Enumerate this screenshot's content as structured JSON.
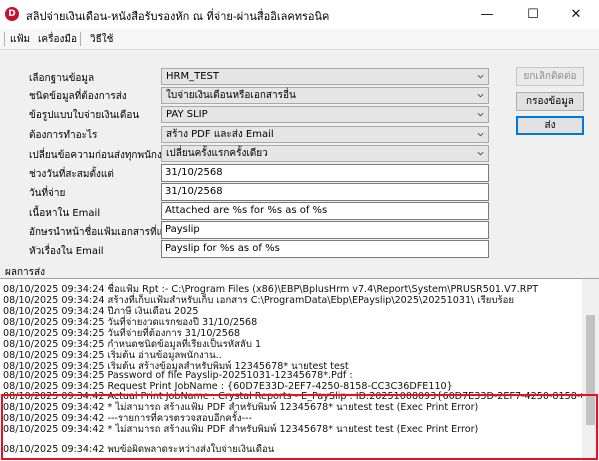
{
  "window": {
    "app_icon_letter": "D",
    "title": "สลิปจ่ายเงินเดือน-หนังสือรับรองหัก ณ ที่จ่าย-ผ่านสื่ออิเลคทรอนิค",
    "controls": {
      "minimize": "—",
      "maximize": "☐",
      "close": "✕"
    }
  },
  "menu": {
    "items": [
      "แฟ้ม",
      "เครื่องมือ",
      "วิธีใช้"
    ]
  },
  "form": {
    "rows": [
      {
        "label": "เลือกฐานข้อมูล",
        "value": "HRM_TEST"
      },
      {
        "label": "ชนิดข้อมูลที่ต้องการส่ง",
        "value": "ใบจ่ายเงินเดือนหรือเอกสารอื่น"
      },
      {
        "label": "ข้อรูปแบบใบจ่ายเงินเดือน",
        "value": "PAY SLIP"
      },
      {
        "label": "ต้องการทำอะไร",
        "value": "สร้าง PDF และส่ง Email"
      },
      {
        "label": "เปลี่ยนข้อความก่อนส่งทุกพนักงาน",
        "value": "เปลี่ยนครั้งแรกครั้งเดียว"
      },
      {
        "label": "ช่วงวันที่สะสมตั้งแต่",
        "value": "31/10/2568"
      },
      {
        "label": "วันที่จ่าย",
        "value": "31/10/2568"
      },
      {
        "label": "เนื้อหาใน Email",
        "value": "Attached are %s for %s as of %s"
      },
      {
        "label": "อักษรนำหน้าชื่อแฟ้มเอกสารที่แนบ",
        "value": "Payslip"
      },
      {
        "label": "หัวเรื่องใน Email",
        "value": "Payslip for %s as of %s"
      }
    ]
  },
  "buttons": {
    "cancel": "ยกเลิกติดต่อ",
    "filter": "กรองข้อมูล",
    "send": "ส่ง"
  },
  "results": {
    "label": "ผลการส่ง",
    "lines": [
      "08/10/2025 09:34:24 ชื่อแฟ้ม Rpt :- C:\\Program Files (x86)\\EBP\\BplusHrm v7.4\\Report\\System\\PRUSR501.V7.RPT",
      "08/10/2025 09:34:24 สร้างที่เก็บแฟ้มสำหรับเก็บ เอกสาร C:\\ProgramData\\Ebp\\EPayslip\\2025\\20251031\\ เรียบร้อย",
      "08/10/2025 09:34:24 ปีภาษี เงินเดือน 2025",
      "08/10/2025 09:34:25 วันที่จ่ายงวดแรกของปี 31/10/2568",
      "08/10/2025 09:34:25 วันที่จ่ายที่ต้องการ 31/10/2568",
      "08/10/2025 09:34:25 กำหนดชนิดข้อมูลที่เรียงเป็นรหัสลับ 1",
      "08/10/2025 09:34:25 เริ่มต้น อ่านข้อมูลพนักงาน..",
      "08/10/2025 09:34:25 เริ่มต้น สร้างข้อมูลสำหรับพิมพ์ 12345678* นายtest test",
      "08/10/2025 09:34:25 Password of file Payslip-20251031-12345678*.Pdf :",
      "08/10/2025 09:34:25 Request Print JobName : {60D7E33D-2EF7-4250-8158-CC3C36DFE110}",
      "08/10/2025 09:34:42 Actual Print JobName : Crystal Reports - E_PaySlip : ID:20251008093{60D7E33D-2EF7-4250-8158-CC3C36DFE110}",
      "08/10/2025 09:34:42 * ไม่สามารถ สร้างแฟ้ม PDF สำหรับพิมพ์ 12345678* นายtest test (Exec Print Error)",
      "08/10/2025 09:34:42 ---รายการที่ควรตรวจสอบอีกครั้ง---",
      "08/10/2025 09:34:42 * ไม่สามารถ สร้างแฟ้ม PDF สำหรับพิมพ์ 12345678* นายtest test (Exec Print Error)",
      "",
      "08/10/2025 09:34:42 พบข้อผิดพลาดระหว่างส่งใบจ่ายเงินเดือน"
    ]
  },
  "colors": {
    "highlight_border": "#e81123",
    "app_icon": "#c8102e",
    "default_button_border": "#0078d7"
  }
}
